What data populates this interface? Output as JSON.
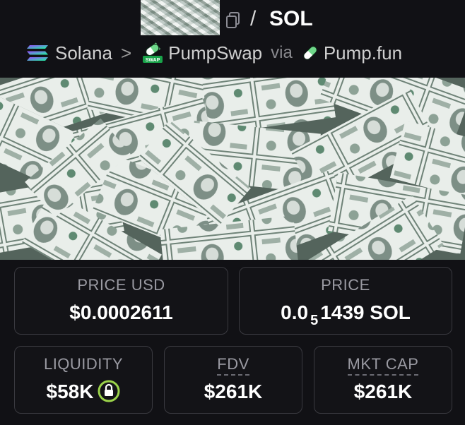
{
  "header": {
    "pair_separator": "/",
    "quote_symbol": "SOL"
  },
  "breadcrumbs": {
    "chain": "Solana",
    "separator": ">",
    "dex": "PumpSwap",
    "dex_badge": "SWAP",
    "via_label": "via",
    "launchpad": "Pump.fun"
  },
  "stats": {
    "price_usd": {
      "label": "PRICE USD",
      "value": "$0.0002611"
    },
    "price_native": {
      "label": "PRICE",
      "prefix": "0.0",
      "zeros_subscript": "5",
      "digits": "1439",
      "unit": "SOL"
    },
    "liquidity": {
      "label": "LIQUIDITY",
      "value": "$58K"
    },
    "fdv": {
      "label": "FDV",
      "value": "$261K"
    },
    "mkt_cap": {
      "label": "MKT CAP",
      "value": "$261K"
    }
  },
  "colors": {
    "background": "#111115",
    "card_border": "#3a3a40",
    "lock_green": "#9bd34a",
    "pump_green": "#7ee08a"
  },
  "icons": {
    "copy": "copy-icon",
    "chain": "solana-logo-icon",
    "dex": "pumpswap-logo-icon",
    "launchpad": "pumpfun-pill-icon",
    "liquidity_lock": "lock-icon"
  }
}
